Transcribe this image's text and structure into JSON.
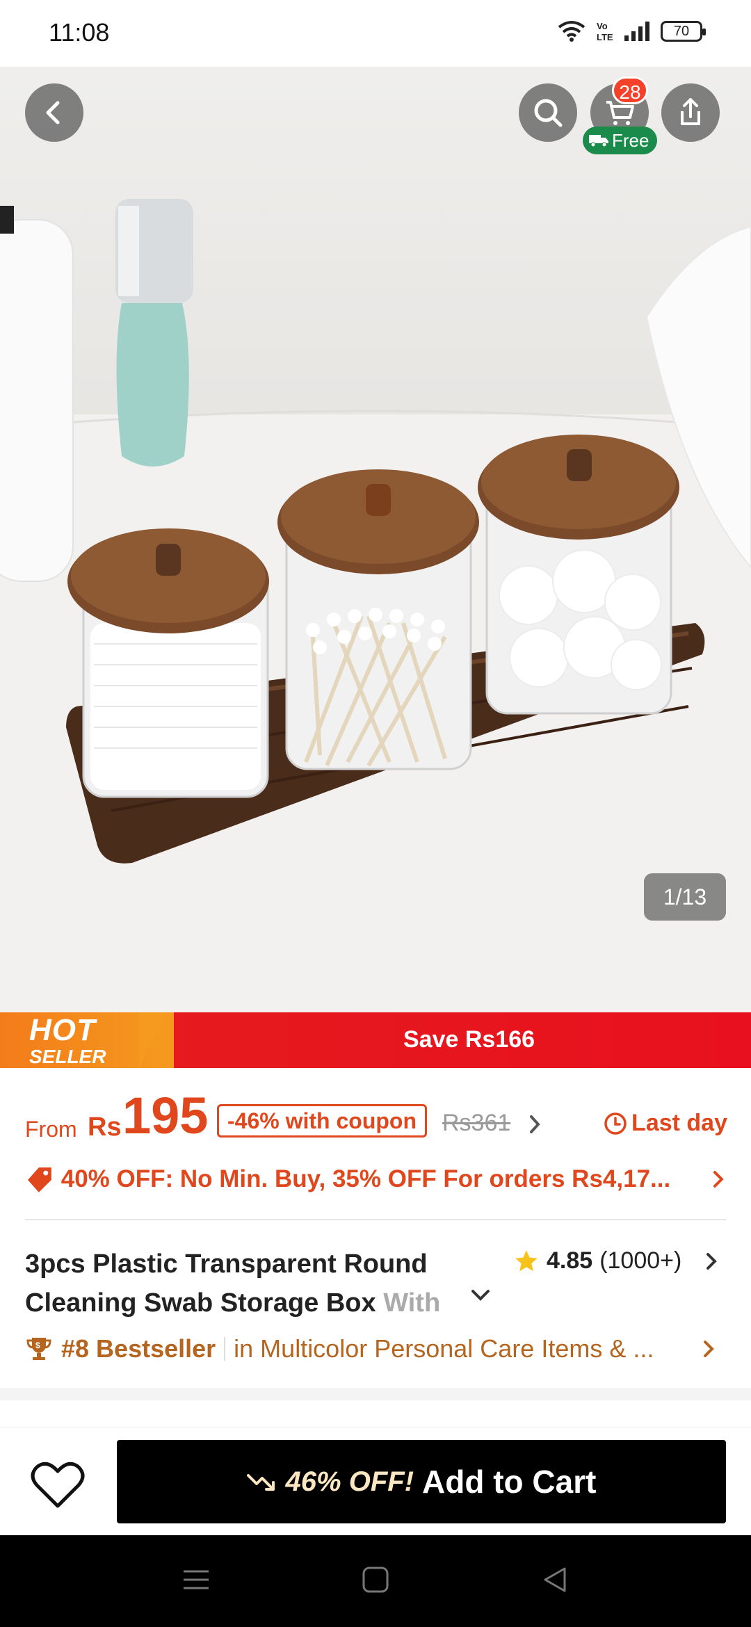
{
  "status_bar": {
    "time": "11:08",
    "battery": "70"
  },
  "hero": {
    "counter": "1/13",
    "cart_badge": "28",
    "free_label": "Free"
  },
  "banner": {
    "hot_line1": "HOT",
    "hot_line2": "SELLER",
    "save_text": "Save Rs166"
  },
  "price": {
    "from_label": "From",
    "currency": "Rs",
    "amount": "195",
    "coupon": "-46% with coupon",
    "original": "Rs361",
    "last_day": "Last day"
  },
  "offer": {
    "text": "40% OFF: No Min. Buy,  35% OFF For orders Rs4,17..."
  },
  "product": {
    "title_main": "3pcs Plastic Transparent Round Cleaning Swab Storage Box",
    "title_fade": "With",
    "rating": "4.85",
    "rating_count": "(1000+)"
  },
  "bestseller": {
    "rank": "#8 Bestseller",
    "category": "in Multicolor Personal Care Items & ..."
  },
  "bottom_bar": {
    "discount": "46% OFF!",
    "add_to_cart": "Add to Cart"
  },
  "colors": {
    "accent": "#e0471c",
    "banner_red": "#e8101e",
    "bestseller": "#b5651d",
    "free_green": "#1a8b4a"
  }
}
